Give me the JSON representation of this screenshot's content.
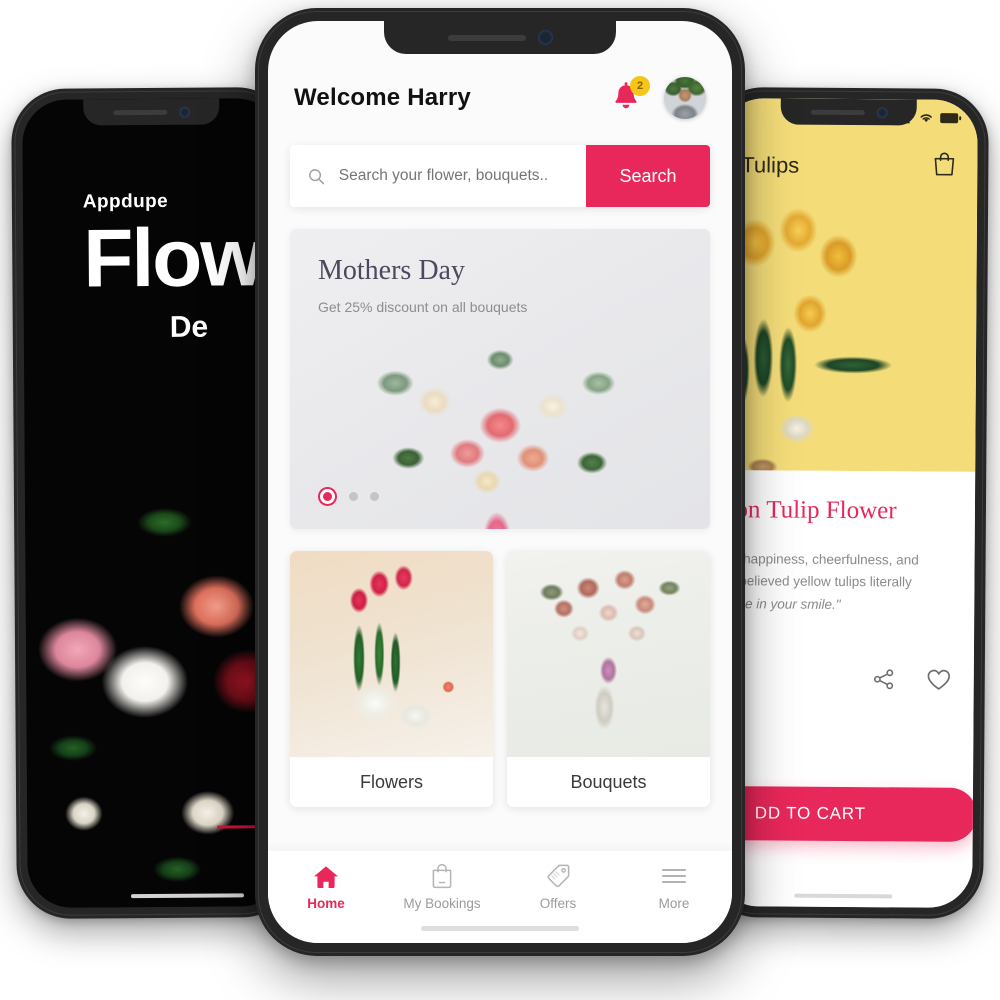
{
  "left_phone": {
    "name": "splash-screen",
    "brand": "Appdupe",
    "title": "Flow",
    "subtitle": "De"
  },
  "center_phone": {
    "name": "home-screen",
    "header": {
      "greeting": "Welcome Harry",
      "notification_count": "2",
      "bell_icon": "bell-icon",
      "avatar_icon": "user-avatar"
    },
    "search": {
      "placeholder": "Search your flower, bouquets..",
      "value": "",
      "button_label": "Search",
      "icon": "search-icon"
    },
    "banner": {
      "title": "Mothers Day",
      "subtitle": "Get 25% discount on all bouquets",
      "dots": 3,
      "active_dot": 0
    },
    "categories": [
      {
        "label": "Flowers",
        "image": "tulips-in-vase"
      },
      {
        "label": "Bouquets",
        "image": "rose-bouquet"
      }
    ],
    "bottom_nav": [
      {
        "label": "Home",
        "icon": "home-icon",
        "active": true
      },
      {
        "label": "My Bookings",
        "icon": "bag-icon",
        "active": false
      },
      {
        "label": "Offers",
        "icon": "tag-icon",
        "active": false
      },
      {
        "label": "More",
        "icon": "hamburger-icon",
        "active": false
      }
    ]
  },
  "right_phone": {
    "name": "product-detail-screen",
    "status_bar": {
      "signal": "signal-icon",
      "wifi": "wifi-icon",
      "battery": "battery-icon"
    },
    "header": {
      "title": "Tulips",
      "cart_icon": "shopping-bag-icon"
    },
    "product": {
      "title": "bon Tulip Flower",
      "description_line1": "ent happiness, cheerfulness, and",
      "description_line2": "en believed yellow tulips literally",
      "description_line3": "shine in your smile.\"",
      "share_icon": "share-icon",
      "favorite_icon": "heart-icon",
      "cart_button_label": "DD TO CART"
    }
  },
  "colors": {
    "accent_pink": "#e8275a",
    "badge_yellow": "#f5c518",
    "hero_yellow": "#f4dd79",
    "dark_bezel": "#262626"
  }
}
